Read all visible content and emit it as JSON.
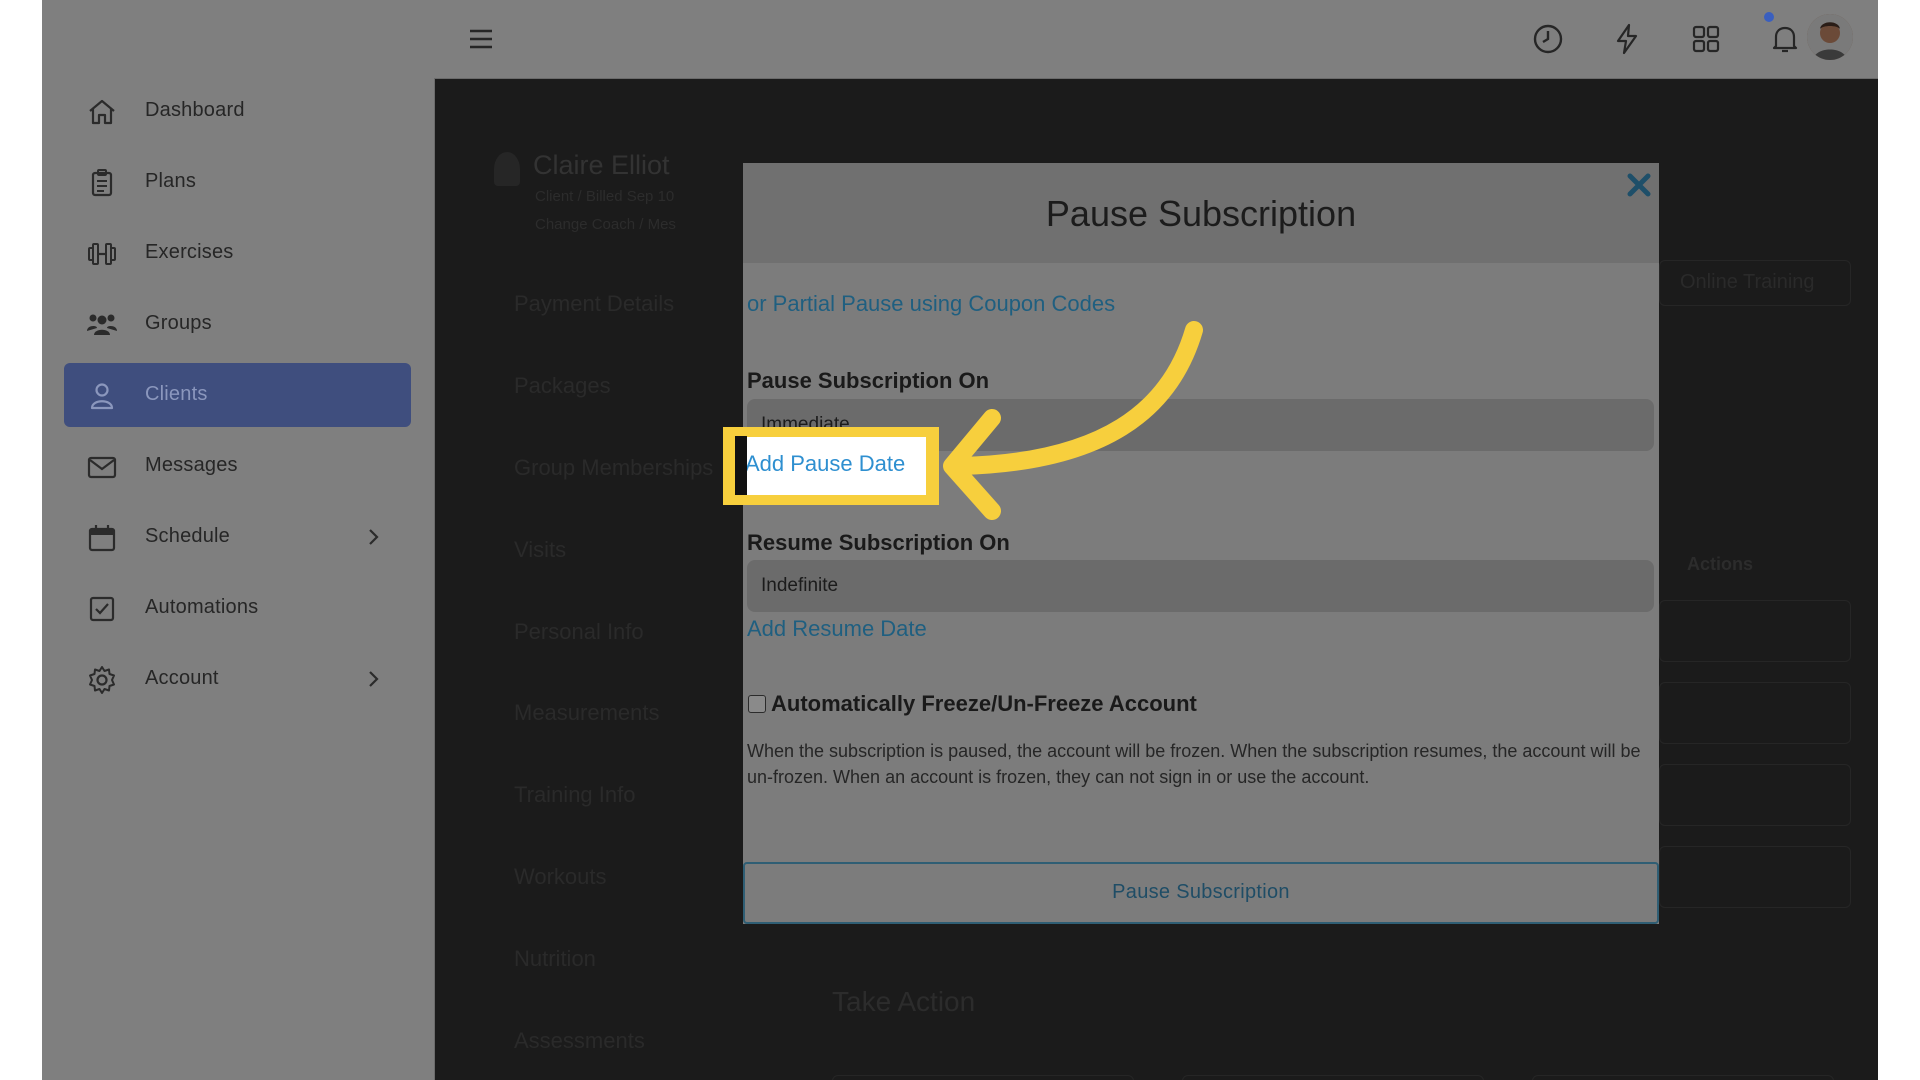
{
  "sidebar": {
    "items": [
      {
        "label": "Dashboard",
        "icon": "home-icon"
      },
      {
        "label": "Plans",
        "icon": "clipboard-icon"
      },
      {
        "label": "Exercises",
        "icon": "dumbbell-icon"
      },
      {
        "label": "Groups",
        "icon": "users-icon"
      },
      {
        "label": "Clients",
        "icon": "user-icon",
        "active": true
      },
      {
        "label": "Messages",
        "icon": "envelope-icon"
      },
      {
        "label": "Schedule",
        "icon": "calendar-icon",
        "has_submenu": true
      },
      {
        "label": "Automations",
        "icon": "checkbox-icon"
      },
      {
        "label": "Account",
        "icon": "gear-icon",
        "has_submenu": true
      }
    ]
  },
  "topbar": {
    "icons": [
      "menu-icon",
      "clock-icon",
      "bolt-icon",
      "grid-icon",
      "bell-icon",
      "avatar"
    ]
  },
  "background": {
    "client_name": "Claire Elliot",
    "client_sub": "Client / Billed Sep 10",
    "client_sub2": "Change Coach / Mes",
    "tabs": [
      "Payment Details",
      "Packages",
      "Group Memberships",
      "Visits",
      "Personal Info",
      "Measurements",
      "Training Info",
      "Workouts",
      "Nutrition",
      "Assessments"
    ],
    "online_training": "Online Training",
    "actions_header": "Actions",
    "take_action": "Take Action"
  },
  "modal": {
    "title": "Pause Subscription",
    "partial_pause_link": "or Partial Pause using Coupon Codes",
    "pause_on_label": "Pause Subscription On",
    "pause_on_value": "Immediate",
    "add_pause_date": "Add Pause Date",
    "resume_on_label": "Resume Subscription On",
    "resume_on_value": "Indefinite",
    "add_resume_date": "Add Resume Date",
    "freeze_label": "Automatically Freeze/Un-Freeze Account",
    "freeze_help": "When the subscription is paused, the account will be frozen. When the subscription resumes, the account will be un-frozen. When an account is frozen, they can not sign in or use the account.",
    "submit_label": "Pause Subscription"
  },
  "colors": {
    "highlight": "#f7cf3d",
    "link": "#2e8fd0",
    "active_nav": "#3f4e7e"
  }
}
